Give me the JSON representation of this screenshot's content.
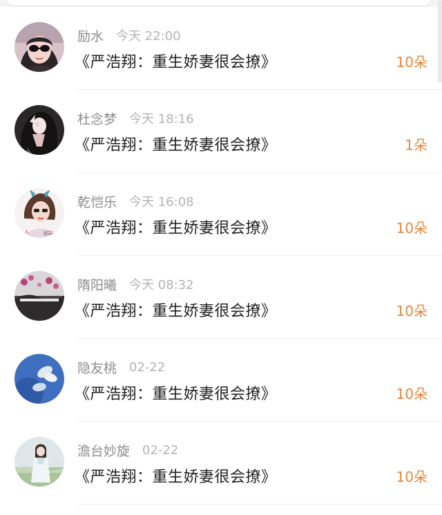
{
  "gifts": [
    {
      "user": "励水",
      "time": "今天 22:00",
      "title": "《严浩翔：重生娇妻很会撩》",
      "amount": "10朵",
      "avatar": "avatar-sunglasses-girl"
    },
    {
      "user": "杜念梦",
      "time": "今天 18:16",
      "title": "《严浩翔：重生娇妻很会撩》",
      "amount": "1朵",
      "avatar": "avatar-dark-hair-girl"
    },
    {
      "user": "乾恺乐",
      "time": "今天 16:08",
      "title": "《严浩翔：重生娇妻很会撩》",
      "amount": "10朵",
      "avatar": "avatar-bow-girl"
    },
    {
      "user": "隋阳曦",
      "time": "今天 08:32",
      "title": "《严浩翔：重生娇妻很会撩》",
      "amount": "10朵",
      "avatar": "avatar-flowers-bw"
    },
    {
      "user": "隐友桃",
      "time": "02-22",
      "title": "《严浩翔：重生娇妻很会撩》",
      "amount": "10朵",
      "avatar": "avatar-blue-flower"
    },
    {
      "user": "澹台妙旋",
      "time": "02-22",
      "title": "《严浩翔：重生娇妻很会撩》",
      "amount": "10朵",
      "avatar": "avatar-field-girl"
    }
  ],
  "colors": {
    "amount": "#e8853a",
    "username": "#8c8c8c",
    "time": "#b3b3b3",
    "title": "#222222"
  }
}
